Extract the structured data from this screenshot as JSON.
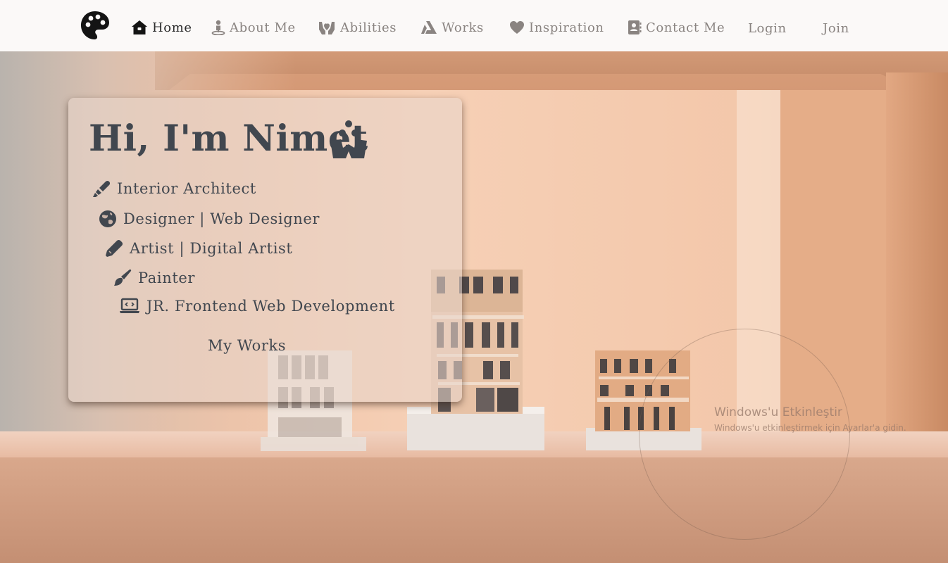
{
  "nav": {
    "items": [
      {
        "label": "Home",
        "icon": "house-icon",
        "active": true
      },
      {
        "label": "About Me",
        "icon": "person-pin-icon",
        "active": false
      },
      {
        "label": "Abilities",
        "icon": "hands-holding-icon",
        "active": false
      },
      {
        "label": "Works",
        "icon": "triangle-a-icon",
        "active": false
      },
      {
        "label": "Inspiration",
        "icon": "heart-icon",
        "active": false
      },
      {
        "label": "Contact Me",
        "icon": "address-book-icon",
        "active": false
      }
    ],
    "login_label": "Login",
    "join_label": "Join"
  },
  "intro": {
    "greeting": "Hi, I'm Nimet",
    "roles": [
      {
        "label": "Interior Architect",
        "icon": "highlighter-icon"
      },
      {
        "label": "Designer | Web Designer",
        "icon": "earth-icon"
      },
      {
        "label": "Artist | Digital Artist",
        "icon": "pen-icon"
      },
      {
        "label": "Painter",
        "icon": "paintbrush-icon"
      },
      {
        "label": "JR. Frontend Web Development",
        "icon": "laptop-code-icon"
      }
    ],
    "cta_label": "My Works"
  },
  "watermark": {
    "title": "Windows'u Etkinleştir",
    "subtitle": "Windows'u etkinleştirmek için Ayarlar'a gidin."
  },
  "colors": {
    "nav_bg": "#fbf9f8",
    "nav_text": "#8a8481",
    "nav_active": "#2b2b2b",
    "card_text": "#41474f",
    "hero_wall": "#f0c3a6",
    "hero_floor": "#c9967a"
  }
}
